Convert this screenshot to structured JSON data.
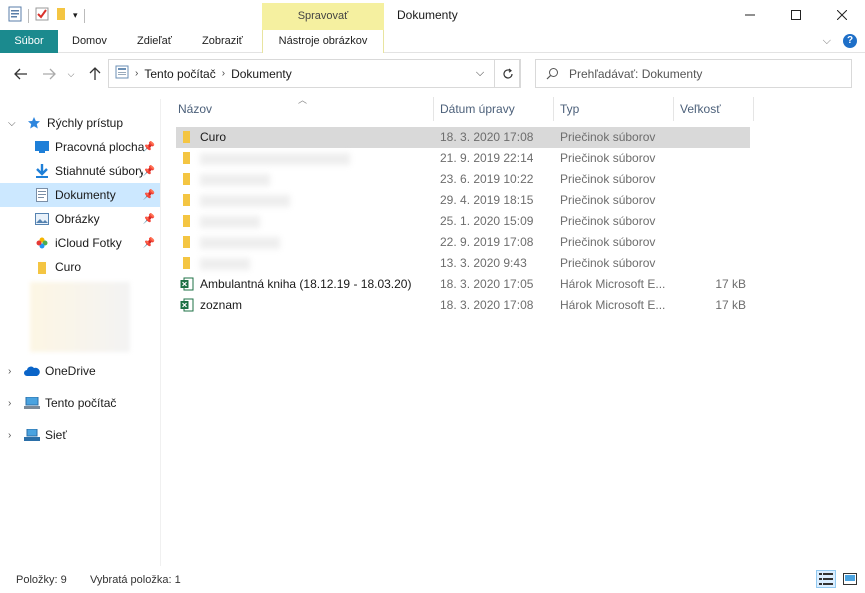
{
  "window": {
    "title": "Dokumenty",
    "contextual_tab_group": "Spravovať"
  },
  "ribbon": {
    "tabs": [
      "Súbor",
      "Domov",
      "Zdieľať",
      "Zobraziť",
      "Nástroje obrázkov"
    ]
  },
  "address": {
    "segments": [
      "Tento počítač",
      "Dokumenty"
    ]
  },
  "search": {
    "placeholder": "Prehľadávať: Dokumenty"
  },
  "navpane": {
    "quick_access": "Rýchly prístup",
    "items": [
      {
        "label": "Pracovná plocha",
        "icon": "desktop-icon",
        "pinned": true
      },
      {
        "label": "Stiahnuté súbory",
        "icon": "download-icon",
        "pinned": true
      },
      {
        "label": "Dokumenty",
        "icon": "document-icon",
        "pinned": true,
        "selected": true
      },
      {
        "label": "Obrázky",
        "icon": "pictures-icon",
        "pinned": true
      },
      {
        "label": "iCloud Fotky",
        "icon": "icloud-photos-icon",
        "pinned": true
      },
      {
        "label": "Curo",
        "icon": "folder-icon",
        "pinned": false
      }
    ],
    "roots": [
      {
        "label": "OneDrive",
        "icon": "onedrive-icon"
      },
      {
        "label": "Tento počítač",
        "icon": "computer-icon"
      },
      {
        "label": "Sieť",
        "icon": "network-icon"
      }
    ]
  },
  "columns": {
    "name": "Názov",
    "date": "Dátum úpravy",
    "type": "Typ",
    "size": "Veľkosť"
  },
  "files": [
    {
      "name": "Curo",
      "date": "18. 3. 2020 17:08",
      "type": "Priečinok súborov",
      "size": "",
      "icon": "folder-icon",
      "selected": true
    },
    {
      "name": "",
      "date": "21. 9. 2019 22:14",
      "type": "Priečinok súborov",
      "size": "",
      "icon": "folder-icon"
    },
    {
      "name": "",
      "date": "23. 6. 2019 10:22",
      "type": "Priečinok súborov",
      "size": "",
      "icon": "folder-icon"
    },
    {
      "name": "",
      "date": "29. 4. 2019 18:15",
      "type": "Priečinok súborov",
      "size": "",
      "icon": "folder-icon"
    },
    {
      "name": "",
      "date": "25. 1. 2020 15:09",
      "type": "Priečinok súborov",
      "size": "",
      "icon": "folder-icon"
    },
    {
      "name": "",
      "date": "22. 9. 2019 17:08",
      "type": "Priečinok súborov",
      "size": "",
      "icon": "folder-icon"
    },
    {
      "name": "",
      "date": "13. 3. 2020 9:43",
      "type": "Priečinok súborov",
      "size": "",
      "icon": "folder-icon"
    },
    {
      "name": "Ambulantná kniha (18.12.19 - 18.03.20)",
      "date": "18. 3. 2020 17:05",
      "type": "Hárok Microsoft E...",
      "size": "17 kB",
      "icon": "excel-icon"
    },
    {
      "name": "zoznam",
      "date": "18. 3. 2020 17:08",
      "type": "Hárok Microsoft E...",
      "size": "17 kB",
      "icon": "excel-icon"
    }
  ],
  "status": {
    "items_count": "Položky: 9",
    "selected": "Vybratá položka: 1"
  },
  "colors": {
    "file_tab": "#1b8a8e",
    "manage_tab": "#f5f0a0",
    "selection": "#cce8ff",
    "row_selected": "#d9d9d9"
  }
}
